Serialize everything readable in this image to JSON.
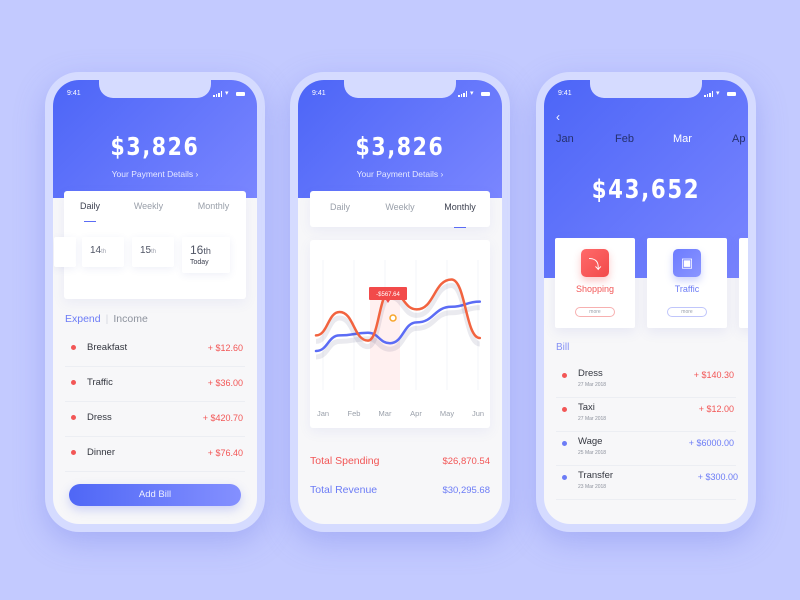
{
  "status_bar": {
    "time": "9:41"
  },
  "colors": {
    "primary": "#5b6cf5",
    "expense": "#f25656",
    "income": "#6c7cf6",
    "background": "#c3caff"
  },
  "screen1": {
    "amount": "$3,826",
    "subtitle": "Your Payment Details",
    "tabs": [
      {
        "label": "Daily",
        "active": true
      },
      {
        "label": "Weekly",
        "active": false
      },
      {
        "label": "Monthly",
        "active": false
      }
    ],
    "days": [
      {
        "num": "14",
        "suffix": "th"
      },
      {
        "num": "15",
        "suffix": "th"
      },
      {
        "num": "16",
        "suffix": "th",
        "note": "Today"
      }
    ],
    "switch": {
      "expend": "Expend",
      "income": "Income"
    },
    "items": [
      {
        "name": "Breakfast",
        "value": "+ $12.60"
      },
      {
        "name": "Traffic",
        "value": "+ $36.00"
      },
      {
        "name": "Dress",
        "value": "+ $420.70"
      },
      {
        "name": "Dinner",
        "value": "+ $76.40"
      }
    ],
    "add_button": "Add Bill"
  },
  "screen2": {
    "amount": "$3,826",
    "subtitle": "Your Payment Details",
    "tabs": [
      {
        "label": "Daily",
        "active": false
      },
      {
        "label": "Weekly",
        "active": false
      },
      {
        "label": "Monthly",
        "active": true
      }
    ],
    "chart_data": {
      "type": "line",
      "categories": [
        "Jan",
        "Feb",
        "Mar",
        "Apr",
        "May",
        "Jun"
      ],
      "series": [
        {
          "name": "Spending",
          "color": "#f2633f",
          "values": [
            42,
            60,
            38,
            76,
            62,
            85,
            40
          ]
        },
        {
          "name": "Revenue",
          "color": "#5b6cf5",
          "values": [
            30,
            42,
            44,
            36,
            52,
            64,
            68
          ]
        }
      ],
      "x_points": [
        0,
        0.75,
        1.65,
        2.35,
        3.2,
        4.3,
        5.2
      ],
      "highlight": {
        "category": "Mar",
        "label": "-$567.64"
      },
      "ylim": [
        0,
        100
      ],
      "grid": true
    },
    "totals": [
      {
        "label": "Total Spending",
        "value": "$26,870.54"
      },
      {
        "label": "Total Revenue",
        "value": "$30,295.68"
      }
    ]
  },
  "screen3": {
    "months": [
      "Jan",
      "Feb",
      "Mar",
      "Ap"
    ],
    "amount": "$43,652",
    "categories": [
      {
        "label": "Shopping",
        "icon": "shoe-icon",
        "more": "more"
      },
      {
        "label": "Traffic",
        "icon": "car-icon",
        "more": "more"
      }
    ],
    "bill_label": "Bill",
    "bills": [
      {
        "name": "Dress",
        "date": "27 Mar 2018",
        "value": "+ $140.30",
        "type": "expense"
      },
      {
        "name": "Taxi",
        "date": "27 Mar 2018",
        "value": "+ $12.00",
        "type": "expense"
      },
      {
        "name": "Wage",
        "date": "25 Mar 2018",
        "value": "+ $6000.00",
        "type": "income"
      },
      {
        "name": "Transfer",
        "date": "23 Mar 2018",
        "value": "+ $300.00",
        "type": "income"
      }
    ]
  }
}
